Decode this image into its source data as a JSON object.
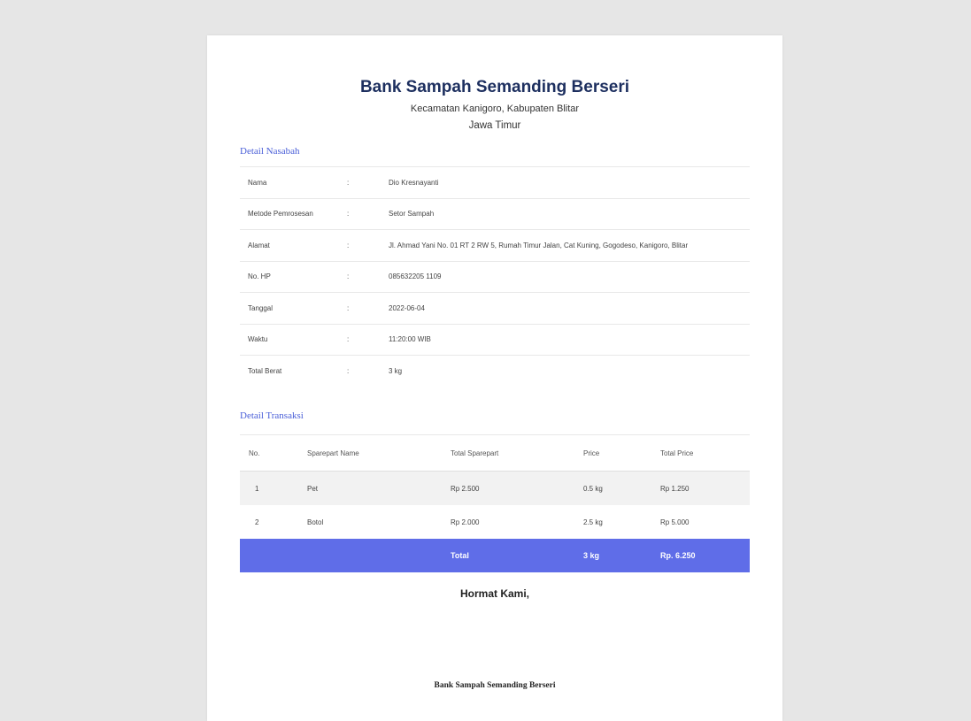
{
  "header": {
    "title": "Bank Sampah Semanding Berseri",
    "subtitle_line1": "Kecamatan Kanigoro, Kabupaten Blitar",
    "subtitle_line2": "Jawa Timur"
  },
  "customer": {
    "section_title": "Detail Nasabah",
    "rows": [
      {
        "label": "Nama",
        "sep": ":",
        "value": "Dio Kresnayanti"
      },
      {
        "label": "Metode Pemrosesan",
        "sep": ":",
        "value": "Setor Sampah"
      },
      {
        "label": "Alamat",
        "sep": ":",
        "value": "Jl. Ahmad Yani No. 01 RT 2 RW 5, Rumah Timur Jalan, Cat Kuning, Gogodeso, Kanigoro, Blitar"
      },
      {
        "label": "No. HP",
        "sep": ":",
        "value": "085632205 1109"
      },
      {
        "label": "Tanggal",
        "sep": ":",
        "value": "2022-06-04"
      },
      {
        "label": "Waktu",
        "sep": ":",
        "value": "11:20:00 WIB"
      },
      {
        "label": "Total Berat",
        "sep": ":",
        "value": "3 kg"
      }
    ]
  },
  "transaction": {
    "section_title": "Detail Transaksi",
    "headers": {
      "no": "No.",
      "name": "Sparepart Name",
      "total": "Total Sparepart",
      "price": "Price",
      "total_price": "Total Price"
    },
    "rows": [
      {
        "no": "1",
        "name": "Pet",
        "total": "Rp 2.500",
        "price": "0.5 kg",
        "total_price": "Rp 1.250"
      },
      {
        "no": "2",
        "name": "Botol",
        "total": "Rp 2.000",
        "price": "2.5 kg",
        "total_price": "Rp 5.000"
      }
    ],
    "footer": {
      "label": "Total",
      "weight": "3 kg",
      "amount": "Rp. 6.250"
    }
  },
  "closing": {
    "regards": "Hormat Kami,",
    "organization": "Bank Sampah Semanding Berseri"
  },
  "colors": {
    "background": "#e6e6e6",
    "title": "#1d2f5f",
    "section_title": "#4a5fd8",
    "total_row": "#5f6de8"
  }
}
